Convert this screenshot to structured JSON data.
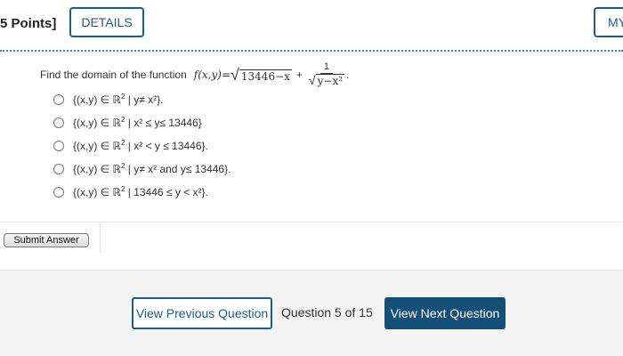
{
  "header": {
    "points_label": "5 Points]",
    "details_label": "DETAILS",
    "my_label": "MY"
  },
  "question": {
    "prompt": "Find the domain of the function",
    "function_lhs": "f(x,y)=",
    "sqrt_radicand": "13446−x",
    "plus": "+",
    "frac_num": "1",
    "frac_den": "y−x²",
    "end": "."
  },
  "options": [
    {
      "set_prefix": "{(x,y) ∈ ℝ",
      "exp": "2",
      "condition": " | y≠ x²}."
    },
    {
      "set_prefix": "{(x,y) ∈ ℝ",
      "exp": "2",
      "condition": " | x² ≤ y≤ 13446}"
    },
    {
      "set_prefix": "{(x,y) ∈ ℝ",
      "exp": "2",
      "condition": " | x² < y ≤ 13446}."
    },
    {
      "set_prefix": "{(x,y) ∈ ℝ",
      "exp": "2",
      "condition": " | y≠ x² and y≤ 13446}."
    },
    {
      "set_prefix": "{(x,y) ∈ ℝ",
      "exp": "2",
      "condition": " | 13446 ≤ y < x²}."
    }
  ],
  "submit_label": "Submit Answer",
  "nav": {
    "prev_label": "View Previous Question",
    "counter": "Question 5 of 15",
    "next_label": "View Next Question"
  },
  "colors": {
    "accent": "#1f5b84",
    "next_bg": "#144f78",
    "nav_bg": "#f3f3f3"
  }
}
